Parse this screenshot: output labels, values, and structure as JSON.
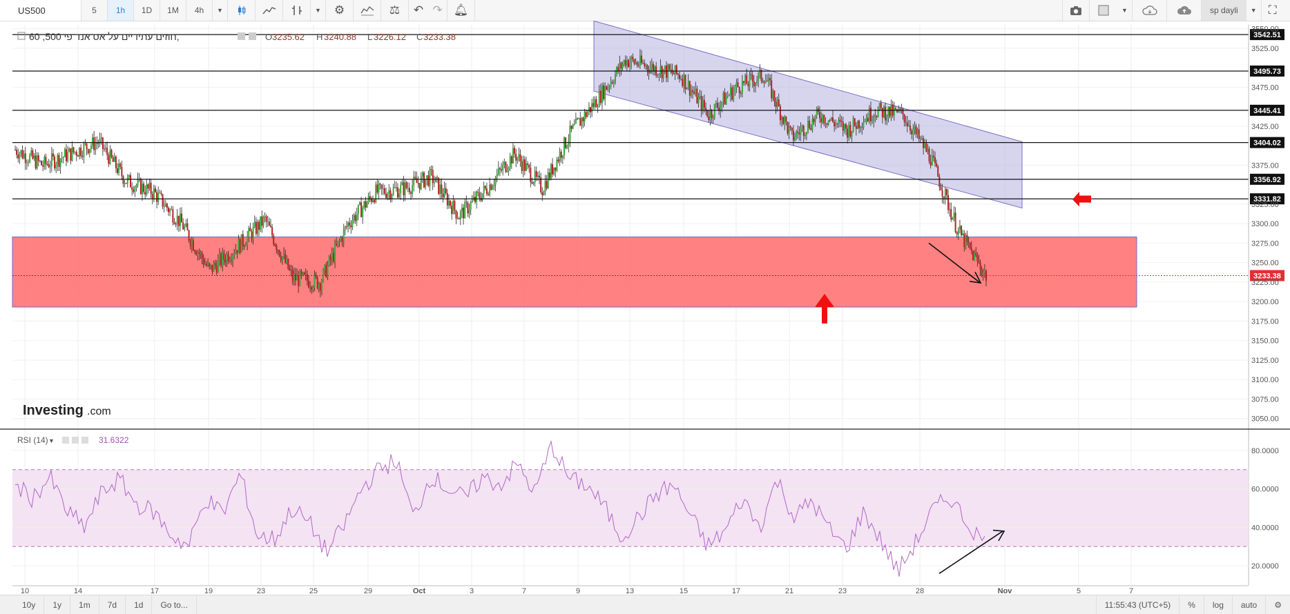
{
  "toolbar": {
    "symbol": "US500",
    "intervals": [
      "5",
      "1h",
      "1D",
      "1M",
      "4h"
    ],
    "active_interval": "1h",
    "user_layout": "sp dayli",
    "icons": [
      "candlestick-icon",
      "line-chart-icon",
      "ohlc-bars-icon",
      "settings-gear-icon",
      "indicators-icon",
      "compare-scale-icon",
      "undo-icon",
      "redo-icon",
      "alert-bell-icon",
      "camera-icon",
      "layout-square-icon",
      "cloud-load-icon",
      "cloud-save-icon",
      "fullscreen-icon"
    ]
  },
  "legend": {
    "title": "חוזים עתידיים על אס אנד פי 500, 60,",
    "open_label": "O",
    "open": "3235.62",
    "high_label": "H",
    "high": "3240.88",
    "low_label": "L",
    "low": "3226.12",
    "close_label": "C",
    "close": "3233.38"
  },
  "rsi": {
    "label": "RSI (14)",
    "value": "31.6322"
  },
  "logo": {
    "brand": "Investing",
    "suffix": ".com"
  },
  "bottom": {
    "ranges": [
      "10y",
      "1y",
      "1m",
      "7d",
      "1d",
      "Go to..."
    ],
    "time": "11:55:43 (UTC+5)",
    "options": [
      "%",
      "log",
      "auto"
    ]
  },
  "colors": {
    "up_candle": "#3aa83a",
    "down_candle": "#b22222",
    "channel_fill": "#b7b2e0",
    "zone_fill": "#ff6b6b",
    "rsi_line": "#b266c7",
    "rsi_band": "#f3e3f3",
    "last_price": "#e03030",
    "arrow": "#ee1111"
  },
  "chart_data": [
    {
      "type": "candlestick",
      "title": "חוזים עתידיים על אס אנד פי 500, 60,",
      "x_ticks": [
        "10",
        "14",
        "17",
        "19",
        "23",
        "25",
        "29",
        "Oct",
        "3",
        "7",
        "9",
        "13",
        "15",
        "17",
        "21",
        "23",
        "28",
        "Nov",
        "5",
        "7"
      ],
      "y_ticks": [
        3050,
        3075,
        3100,
        3125,
        3150,
        3175,
        3200,
        3225,
        3250,
        3275,
        3300,
        3325,
        3375,
        3425,
        3475,
        3525,
        3550
      ],
      "ylim": [
        3040,
        3555
      ],
      "horizontal_levels": [
        3542.51,
        3495.73,
        3445.41,
        3404.02,
        3356.92,
        3331.82
      ],
      "last_price": 3233.38,
      "series": [
        {
          "name": "",
          "x": [
            "Sep 10",
            "Sep 11",
            "Sep 12",
            "Sep 13",
            "Sep 16",
            "Sep 17",
            "Sep 18",
            "Sep 19",
            "Sep 20",
            "Sep 23",
            "Sep 24",
            "Sep 25",
            "Sep 26",
            "Sep 27",
            "Sep 30",
            "Oct 1",
            "Oct 2",
            "Oct 3",
            "Oct 4",
            "Oct 7",
            "Oct 8",
            "Oct 9",
            "Oct 10",
            "Oct 11",
            "Oct 14",
            "Oct 15",
            "Oct 16",
            "Oct 17",
            "Oct 18",
            "Oct 21",
            "Oct 22",
            "Oct 23",
            "Oct 24",
            "Oct 25",
            "Oct 28",
            "Oct 29"
          ],
          "close": [
            3395,
            3375,
            3390,
            3405,
            3355,
            3340,
            3300,
            3240,
            3270,
            3305,
            3230,
            3225,
            3300,
            3340,
            3345,
            3360,
            3310,
            3345,
            3390,
            3345,
            3415,
            3460,
            3510,
            3500,
            3490,
            3440,
            3475,
            3490,
            3410,
            3440,
            3420,
            3445,
            3440,
            3385,
            3290,
            3233
          ]
        }
      ]
    },
    {
      "type": "line",
      "title": "RSI (14)",
      "ylim": [
        10,
        90
      ],
      "y_ticks": [
        20,
        40,
        60,
        80
      ],
      "bands": [
        30,
        70
      ],
      "series": [
        {
          "name": "RSI (14)",
          "values": [
            62,
            55,
            66,
            48,
            40,
            58,
            65,
            52,
            48,
            36,
            30,
            55,
            47,
            68,
            35,
            34,
            50,
            42,
            27,
            41,
            60,
            70,
            75,
            45,
            67,
            60,
            55,
            66,
            62,
            73,
            58,
            83,
            65,
            62,
            51,
            35,
            45,
            57,
            62,
            46,
            30,
            38,
            55,
            40,
            65,
            45,
            54,
            39,
            29,
            48,
            33,
            17,
            32,
            49,
            56,
            42,
            32
          ]
        }
      ]
    }
  ]
}
